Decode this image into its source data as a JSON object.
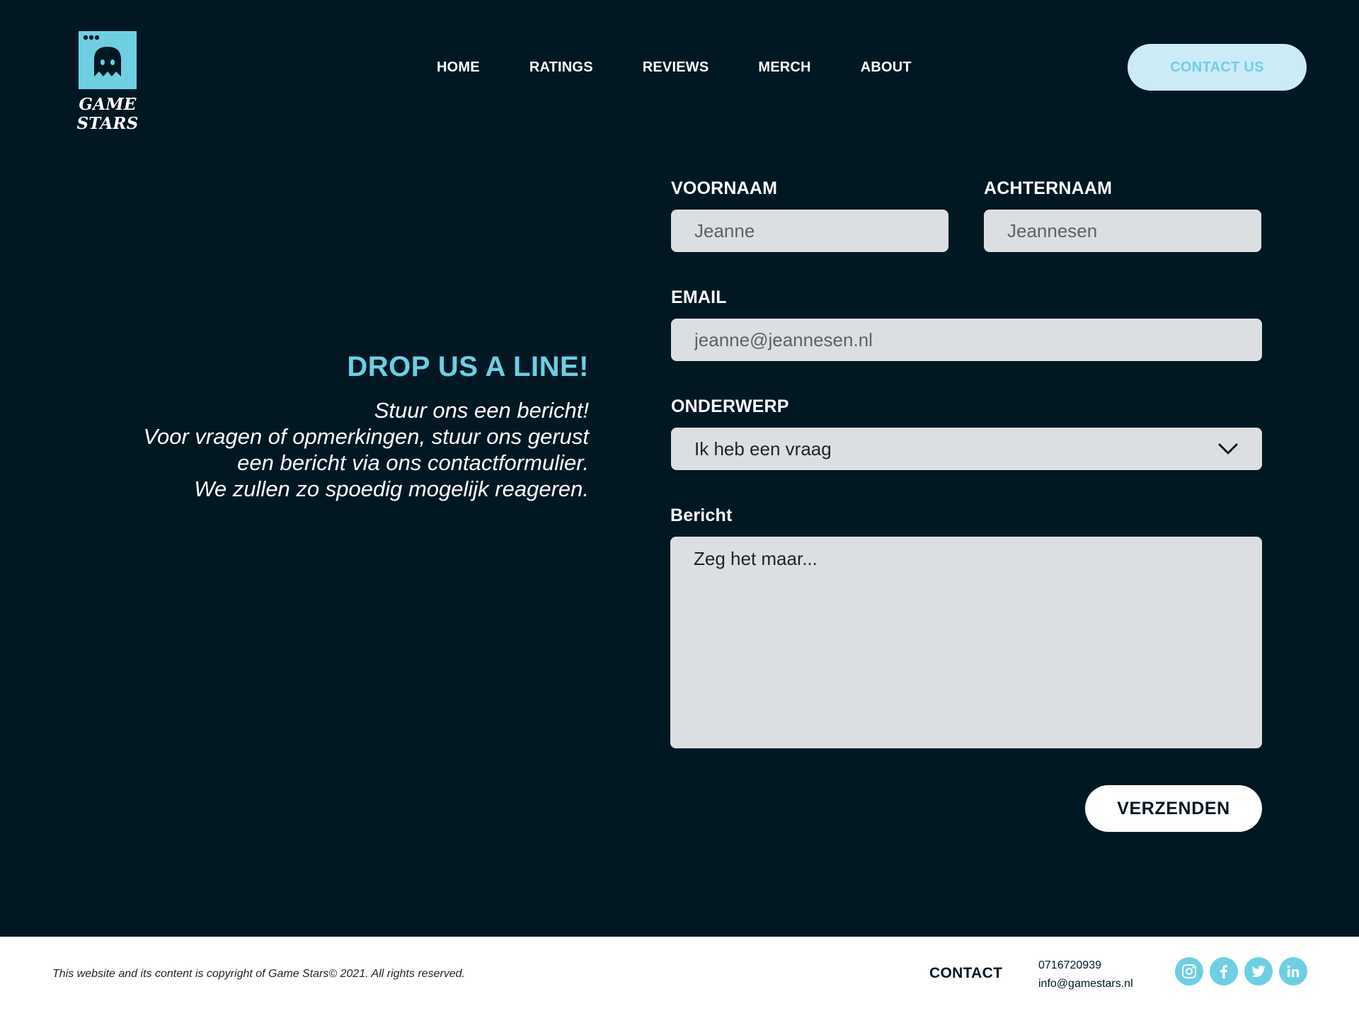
{
  "colors": {
    "background": "#011823",
    "accent": "#6dcfe1",
    "contact_button_bg": "#cdeaf7",
    "field_bg": "#dcdfe1",
    "footer_bg": "#ffffff"
  },
  "header": {
    "logo_text": "GAME STARS",
    "logo_icon": "ghost-icon",
    "nav": [
      "HOME",
      "RATINGS",
      "REVIEWS",
      "MERCH",
      "ABOUT"
    ],
    "contact_button": "CONTACT US"
  },
  "intro": {
    "title": "DROP US A LINE!",
    "lines": [
      "Stuur ons een bericht!",
      "Voor vragen of opmerkingen, stuur ons gerust",
      "een bericht via ons contactformulier.",
      "We zullen zo spoedig mogelijk reageren."
    ]
  },
  "form": {
    "first_name_label": "VOORNAAM",
    "first_name_placeholder": "Jeanne",
    "last_name_label": "ACHTERNAAM",
    "last_name_placeholder": "Jeannesen",
    "email_label": "EMAIL",
    "email_placeholder": "jeanne@jeannesen.nl",
    "subject_label": "ONDERWERP",
    "subject_value": "Ik heb een vraag",
    "message_label": "Bericht",
    "message_placeholder": "Zeg het maar...",
    "submit_label": "VERZENDEN"
  },
  "footer": {
    "copyright": "This website and its content is copyright of Game Stars© 2021. All rights reserved.",
    "contact_label": "CONTACT",
    "phone": "0716720939",
    "email": "info@gamestars.nl",
    "socials": [
      "instagram-icon",
      "facebook-icon",
      "twitter-icon",
      "linkedin-icon"
    ]
  }
}
